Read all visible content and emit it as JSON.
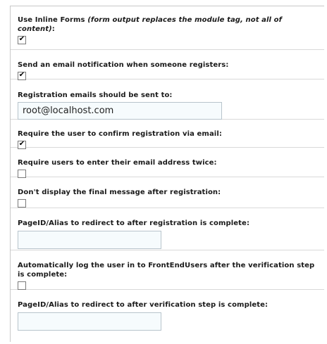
{
  "settings": {
    "inline_forms": {
      "label": "Use Inline Forms",
      "note": "(form output replaces the module tag, not all of content)",
      "suffix": ":",
      "checked": true
    },
    "email_notification": {
      "label": "Send an email notification when someone registers:",
      "checked": true
    },
    "registration_email": {
      "label": "Registration emails should be sent to:",
      "value": "root@localhost.com"
    },
    "confirm_via_email": {
      "label": "Require the user to confirm registration via email:",
      "checked": true
    },
    "email_twice": {
      "label": "Require users to enter their email address twice:",
      "checked": false
    },
    "no_final_message": {
      "label": "Don't display the final message after registration:",
      "checked": false
    },
    "redirect_after_registration": {
      "label": "PageID/Alias to redirect to after registration is complete:",
      "value": ""
    },
    "auto_login": {
      "label": "Automatically log the user in to FrontEndUsers after the verification step is complete:",
      "checked": false
    },
    "redirect_after_verification": {
      "label": "PageID/Alias to redirect to after verification step is complete:",
      "value": ""
    }
  }
}
